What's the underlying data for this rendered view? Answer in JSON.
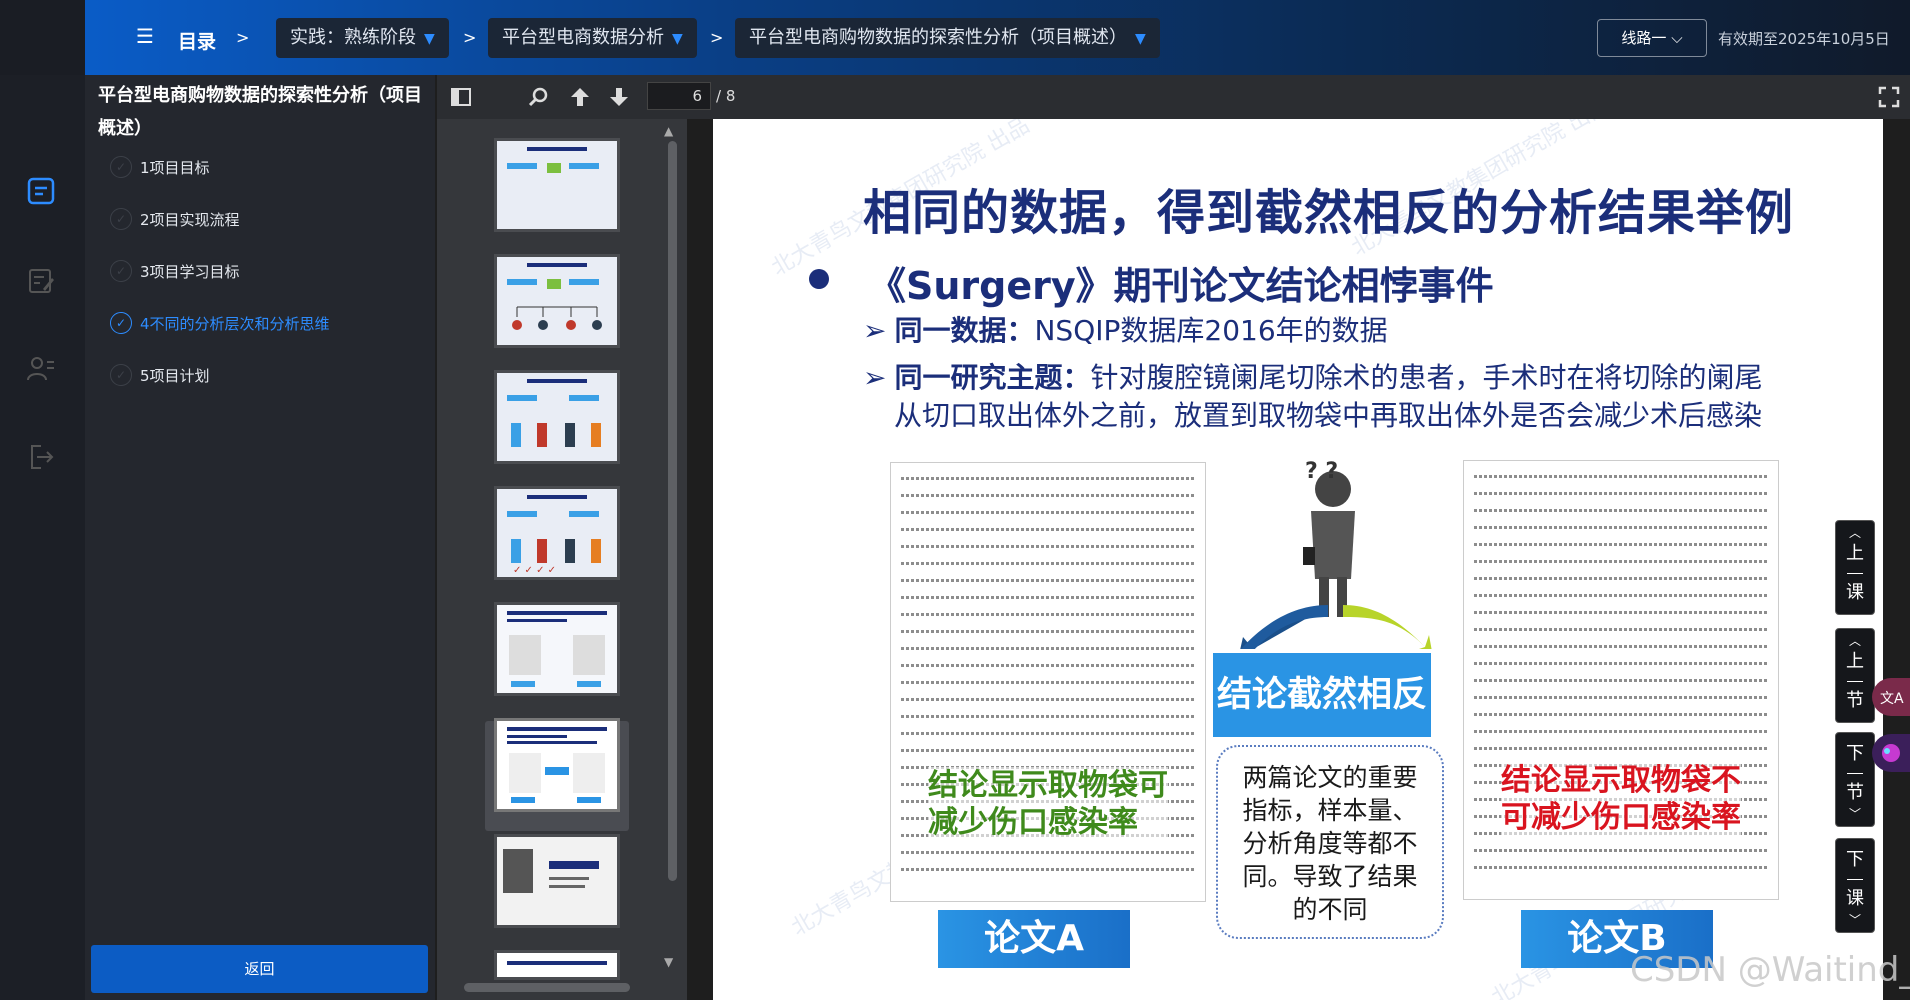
{
  "header": {
    "menu_label": "目录",
    "breadcrumbs": [
      "实践：熟练阶段",
      "平台型电商数据分析",
      "平台型电商购物数据的探索性分析（项目概述）"
    ],
    "separator": ">",
    "route_label": "线路一",
    "validity": "有效期至2025年10月5日"
  },
  "sidebar": {
    "title": "平台型电商购物数据的探索性分析（项目概述）",
    "items": [
      {
        "label": "1项目目标"
      },
      {
        "label": "2项目实现流程"
      },
      {
        "label": "3项目学习目标"
      },
      {
        "label": "4不同的分析层次和分析思维",
        "active": true
      },
      {
        "label": "5项目计划"
      }
    ],
    "back_label": "返回"
  },
  "viewer": {
    "current_page": "6",
    "page_total": "/ 8"
  },
  "slide": {
    "title": "相同的数据，得到截然相反的分析结果举例",
    "bullet": "《Surgery》期刊论文结论相悖事件",
    "sub1_bold": "同一数据：",
    "sub1_text": "NSQIP数据库2016年的数据",
    "sub2_bold": "同一研究主题：",
    "sub2_text_line1": "针对腹腔镜阑尾切除术的患者，手术时在将切除的阑尾",
    "sub2_text_line2": "从切口取出体外之前，放置到取物袋中再取出体外是否会减少术后感染",
    "paper_a_note_line1": "结论显示取物袋可",
    "paper_a_note_line2": "减少伤口感染率",
    "paper_b_note_line1": "结论显示取物袋不",
    "paper_b_note_line2": "可减少伤口感染率",
    "conclusion": "结论截然相反",
    "explanation": [
      "两篇论文的重要",
      "指标，样本量、",
      "分析角度等都不",
      "同。导致了结果",
      "的不同"
    ],
    "label_a": "论文A",
    "label_b": "论文B",
    "question_marks": "? ?",
    "watermark": "北大青鸟文教集团研究院 出品"
  },
  "float_buttons": [
    {
      "top": "上",
      "bottom": "课"
    },
    {
      "top": "上",
      "bottom": "节"
    },
    {
      "top": "下",
      "bottom": "节"
    },
    {
      "top": "下",
      "bottom": "课"
    }
  ],
  "footer_watermark": "CSDN @Waitind_",
  "colors": {
    "accent": "#2d8cff",
    "slide_navy": "#1b2e7a",
    "green_note": "#3f8a1c",
    "red_note": "#d9141f",
    "back_button": "#0c5cc4"
  }
}
